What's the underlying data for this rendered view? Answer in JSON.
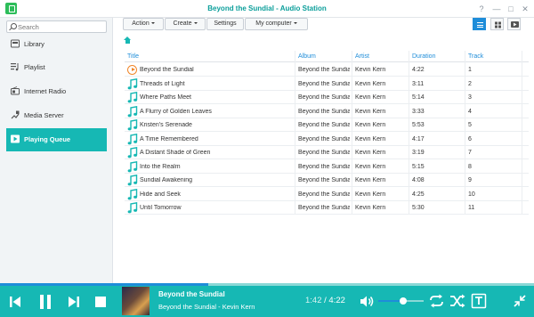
{
  "window": {
    "title": "Beyond the Sundial - Audio Station",
    "controls": [
      "?",
      "—",
      "□",
      "✕"
    ]
  },
  "search": {
    "placeholder": "Search"
  },
  "sidebar": {
    "items": [
      {
        "label": "Library",
        "icon": "library-icon"
      },
      {
        "label": "Playlist",
        "icon": "playlist-icon"
      },
      {
        "label": "Internet Radio",
        "icon": "radio-icon"
      },
      {
        "label": "Media Server",
        "icon": "media-server-icon"
      },
      {
        "label": "Playing Queue",
        "icon": "play-icon",
        "active": true
      }
    ]
  },
  "toolbar": {
    "action_label": "Action",
    "create_label": "Create",
    "settings_label": "Settings",
    "source_label": "My computer",
    "views": [
      "list-view-icon",
      "grid-view-icon",
      "player-view-icon"
    ]
  },
  "table": {
    "columns": [
      "Title",
      "Album",
      "Artist",
      "Duration",
      "Track"
    ],
    "rows": [
      {
        "title": "Beyond the Sundial",
        "album": "Beyond the Sundial",
        "artist": "Kevin Kern",
        "duration": "4:22",
        "track": "1",
        "playing": true
      },
      {
        "title": "Threads of Light",
        "album": "Beyond the Sundial",
        "artist": "Kevin Kern",
        "duration": "3:11",
        "track": "2"
      },
      {
        "title": "Where Paths Meet",
        "album": "Beyond the Sundial",
        "artist": "Kevin Kern",
        "duration": "5:14",
        "track": "3"
      },
      {
        "title": "A Flurry of Golden Leaves",
        "album": "Beyond the Sundial",
        "artist": "Kevin Kern",
        "duration": "3:33",
        "track": "4"
      },
      {
        "title": "Kristen's Serenade",
        "album": "Beyond the Sundial",
        "artist": "Kevin Kern",
        "duration": "5:53",
        "track": "5"
      },
      {
        "title": "A Time Remembered",
        "album": "Beyond the Sundial",
        "artist": "Kevin Kern",
        "duration": "4:17",
        "track": "6"
      },
      {
        "title": "A Distant Shade of Green",
        "album": "Beyond the Sundial",
        "artist": "Kevin Kern",
        "duration": "3:19",
        "track": "7"
      },
      {
        "title": "Into the Realm",
        "album": "Beyond the Sundial",
        "artist": "Kevin Kern",
        "duration": "5:15",
        "track": "8"
      },
      {
        "title": "Sundial Awakening",
        "album": "Beyond the Sundial",
        "artist": "Kevin Kern",
        "duration": "4:08",
        "track": "9"
      },
      {
        "title": "Hide and Seek",
        "album": "Beyond the Sundial",
        "artist": "Kevin Kern",
        "duration": "4:25",
        "track": "10"
      },
      {
        "title": "Until Tomorrow",
        "album": "Beyond the Sundial",
        "artist": "Kevin Kern",
        "duration": "5:30",
        "track": "11"
      }
    ]
  },
  "player": {
    "now_title": "Beyond the Sundial",
    "now_subtitle": "Beyond the Sundial - Kevin Kern",
    "current_time": "1:42",
    "separator": " / ",
    "total_time": "4:22",
    "progress": 0.39,
    "volume": 0.55
  },
  "colors": {
    "accent": "#16b8b4",
    "link_blue": "#1e8dd9",
    "now_playing_orange": "#f0862a"
  }
}
